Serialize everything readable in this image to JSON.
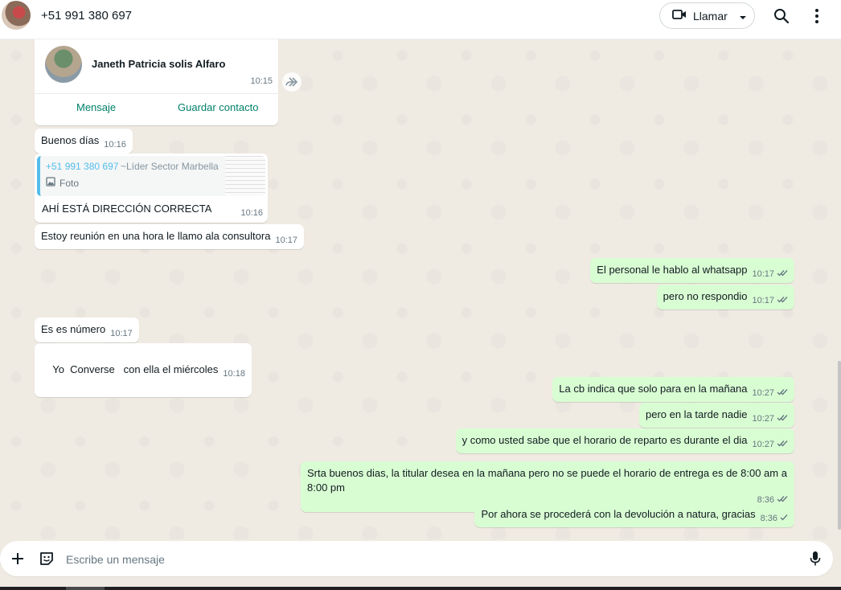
{
  "header": {
    "contact": "+51 991 380 697",
    "call_label": "Llamar",
    "icons": [
      "video-icon",
      "chevron-down-icon",
      "search-icon",
      "more-vert-icon"
    ]
  },
  "contact_card": {
    "name": "Janeth Patricia solis Alfaro",
    "time": "10:15",
    "action_message": "Mensaje",
    "action_save": "Guardar contacto"
  },
  "messages": [
    {
      "text": "Buenos días",
      "time": "10:16",
      "dir": "in"
    },
    {
      "text": "AHÍ ESTÁ DIRECCIÓN CORRECTA",
      "time": "10:16",
      "dir": "in",
      "quote": {
        "author": "+51 991 380 697",
        "alias": "~Líder Sector Marbella",
        "type": "Foto"
      }
    },
    {
      "text": "Estoy reunión en una hora le llamo ala consultora",
      "time": "10:17",
      "dir": "in"
    },
    {
      "text": "El personal le hablo al whatsapp",
      "time": "10:17",
      "dir": "out",
      "status": "read"
    },
    {
      "text": "pero no respondio",
      "time": "10:17",
      "dir": "out",
      "status": "read"
    },
    {
      "text": "Es es número",
      "time": "10:17",
      "dir": "in"
    },
    {
      "text": "Yo  Converse   con ella el miércoles",
      "time": "10:18",
      "dir": "in"
    },
    {
      "text": "La cb indica que solo para en la mañana",
      "time": "10:27",
      "dir": "out",
      "status": "read"
    },
    {
      "text": "pero en la tarde nadie",
      "time": "10:27",
      "dir": "out",
      "status": "read"
    },
    {
      "text": "y como usted sabe que el horario de reparto es durante el dia",
      "time": "10:27",
      "dir": "out",
      "status": "read"
    },
    {
      "text": "Srta buenos dias, la titular desea en la mañana pero no se puede el horario de entrega es de 8:00 am a 8:00 pm",
      "time": "8:36",
      "dir": "out",
      "status": "read"
    },
    {
      "text": "Por ahora se procederá con la devolución a natura, gracias",
      "time": "8:36",
      "dir": "out",
      "status": "sent"
    }
  ],
  "composer": {
    "placeholder": "Escribe un mensaje"
  },
  "colors": {
    "accent": "#008069",
    "outgoing_bubble": "#d9fdd3",
    "incoming_bubble": "#ffffff",
    "read_tick": "#667781",
    "quote_bar": "#53bdeb"
  }
}
